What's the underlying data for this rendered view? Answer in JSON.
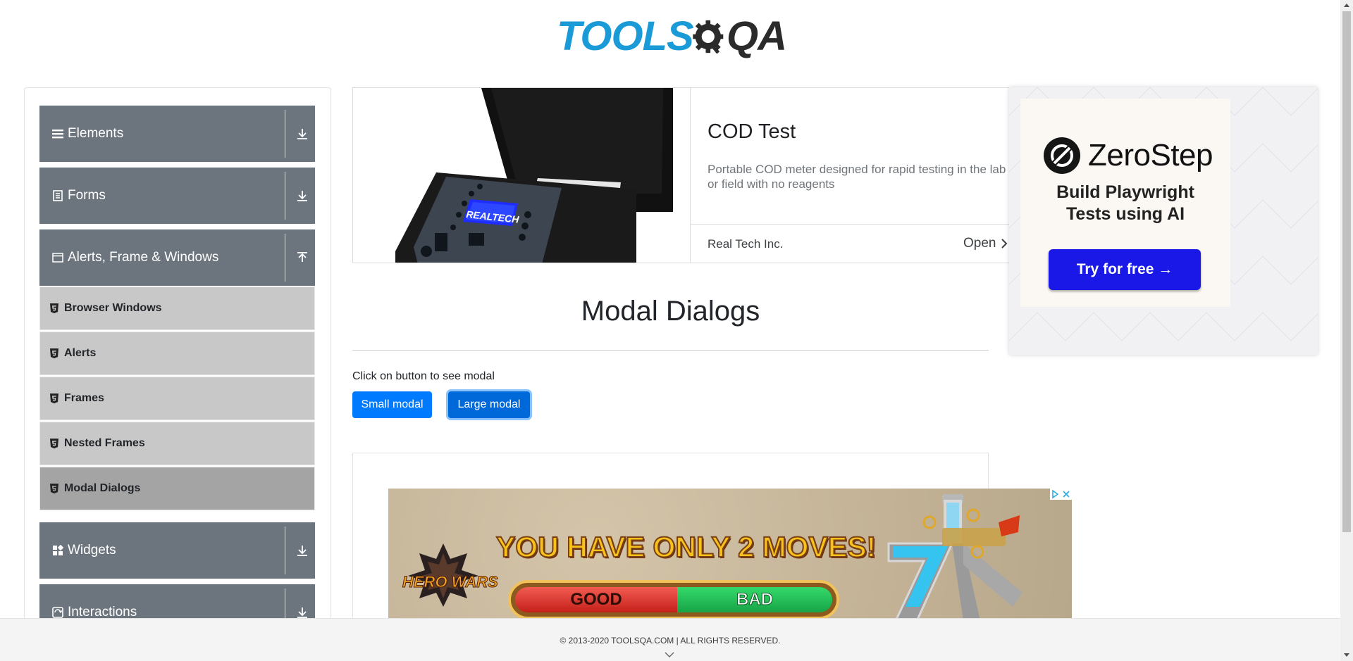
{
  "logo": {
    "text": "TOOLS",
    "suffix": "QA"
  },
  "sidebar": {
    "groups": [
      {
        "label": "Elements",
        "icon": "hamburger-icon",
        "expanded": false
      },
      {
        "label": "Forms",
        "icon": "document-icon",
        "expanded": false
      },
      {
        "label": "Alerts, Frame & Windows",
        "icon": "window-icon",
        "expanded": true
      },
      {
        "label": "Widgets",
        "icon": "grid-icon",
        "expanded": false
      },
      {
        "label": "Interactions",
        "icon": "interact-icon",
        "expanded": false
      }
    ],
    "sub_items": [
      {
        "label": "Browser Windows",
        "active": false
      },
      {
        "label": "Alerts",
        "active": false
      },
      {
        "label": "Frames",
        "active": false
      },
      {
        "label": "Nested Frames",
        "active": false
      },
      {
        "label": "Modal Dialogs",
        "active": true
      }
    ]
  },
  "top_ad": {
    "title": "COD Test",
    "description": "Portable COD meter designed for rapid testing in the lab or field with no reagents",
    "advertiser": "Real Tech Inc.",
    "cta": "Open",
    "device_brand": "REALTECH"
  },
  "side_ad": {
    "brand": "ZeroStep",
    "headline_line1": "Build Playwright",
    "headline_line2": "Tests using AI",
    "button": "Try for free →"
  },
  "main": {
    "title": "Modal Dialogs",
    "hint": "Click on button to see modal",
    "small_button": "Small modal",
    "large_button": "Large modal"
  },
  "banner_ad": {
    "slogan": "YOU HAVE ONLY 2 MOVES!",
    "good": "GOOD",
    "bad": "BAD",
    "logo": "HERO WARS"
  },
  "footer": {
    "text": "© 2013-2020 TOOLSQA.COM | ALL RIGHTS RESERVED."
  },
  "colors": {
    "accent": "#007bff",
    "sidebar_header": "#6c757d",
    "sub_item": "#c8c8c8",
    "sub_item_active": "#a4a4a4",
    "logo_blue": "#1a9ad6"
  }
}
